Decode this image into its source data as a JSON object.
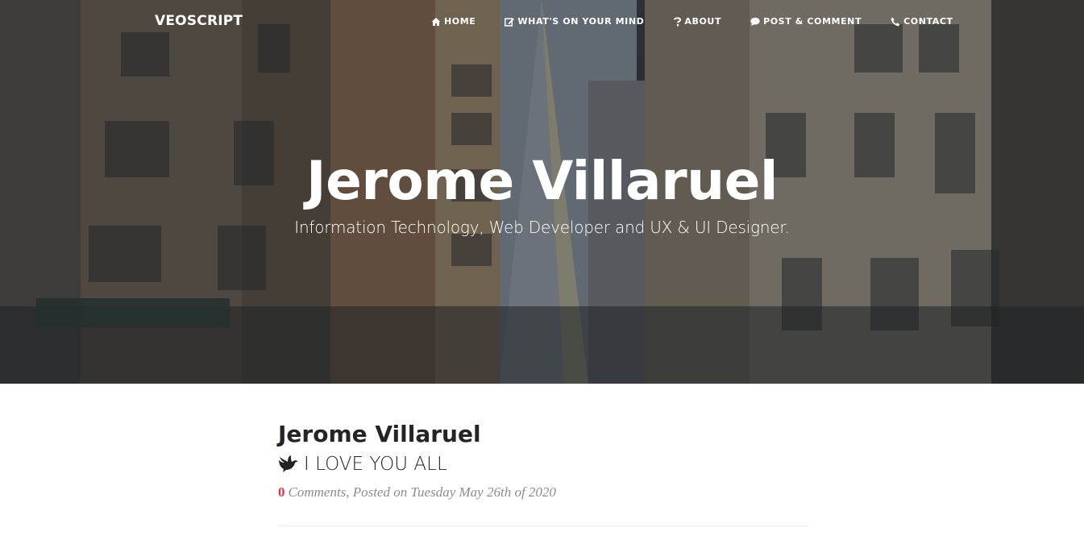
{
  "brand": "VEOSCRIPT",
  "nav": [
    {
      "label": "HOME",
      "icon": "home-icon"
    },
    {
      "label": "WHAT'S ON YOUR MIND",
      "icon": "edit-icon"
    },
    {
      "label": "ABOUT",
      "icon": "question-icon"
    },
    {
      "label": "POST & COMMENT",
      "icon": "comment-icon"
    },
    {
      "label": "CONTACT",
      "icon": "phone-icon"
    }
  ],
  "hero": {
    "title": "Jerome Villaruel",
    "subtitle": "Information Technology, Web Developer and UX & UI Designer.",
    "background_image": "city-street-photo"
  },
  "post": {
    "title": "Jerome Villaruel",
    "subtitle": "I LOVE YOU ALL",
    "subtitle_icon": "dove-icon",
    "comment_count": "0",
    "meta": "Comments, Posted on Tuesday May 26th of 2020"
  },
  "colors": {
    "comment_count": "#dc3545",
    "text": "#212529",
    "meta": "#868e96"
  }
}
